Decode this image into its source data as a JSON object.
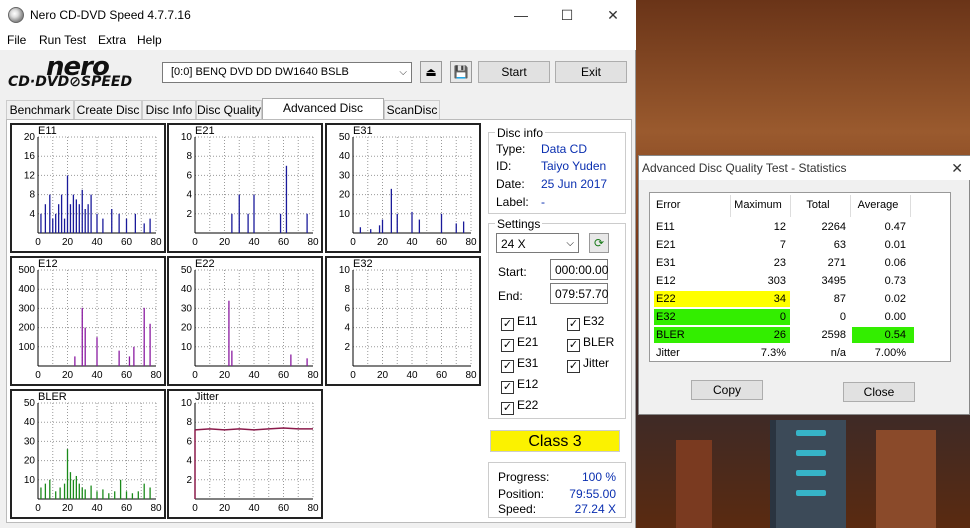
{
  "window": {
    "title": "Nero CD-DVD Speed 4.7.7.16",
    "minimize": "—",
    "maximize": "☐",
    "close": "✕"
  },
  "menu": [
    "File",
    "Run Test",
    "Extra",
    "Help"
  ],
  "logo": {
    "line1": "nero",
    "line2": "CD·DVD⊘SPEED"
  },
  "drive": {
    "value": "[0:0]   BENQ DVD DD DW1640 BSLB",
    "arrow": "⌵"
  },
  "toolbar": {
    "start": "Start",
    "exit": "Exit",
    "eject_icon": "eject-icon",
    "save_icon": "floppy-save-icon"
  },
  "tabs": [
    "Benchmark",
    "Create Disc",
    "Disc Info",
    "Disc Quality",
    "Advanced Disc Quality",
    "ScanDisc"
  ],
  "active_tab": 4,
  "disc_info": {
    "label": "Disc info",
    "type_label": "Type:",
    "type": "Data CD",
    "id_label": "ID:",
    "id": "Taiyo Yuden",
    "date_label": "Date:",
    "date": "25 Jun 2017",
    "label_label": "Label:",
    "label_value": "-"
  },
  "settings": {
    "label": "Settings",
    "speed": "24 X",
    "start_label": "Start:",
    "start": "000:00.00",
    "end_label": "End:",
    "end": "079:57.70"
  },
  "checks": [
    {
      "label": "E11",
      "checked": true
    },
    {
      "label": "E32",
      "checked": true
    },
    {
      "label": "E21",
      "checked": true
    },
    {
      "label": "BLER",
      "checked": true
    },
    {
      "label": "E31",
      "checked": true
    },
    {
      "label": "Jitter",
      "checked": true
    },
    {
      "label": "E12",
      "checked": true
    },
    {
      "label": "E22",
      "checked": true
    }
  ],
  "class_label": "Class 3",
  "progress": {
    "progress_label": "Progress:",
    "progress": "100 %",
    "position_label": "Position:",
    "position": "79:55.00",
    "speed_label": "Speed:",
    "speed": "27.24 X"
  },
  "charts": [
    {
      "name": "E11",
      "ymax": 20,
      "yticks": [
        "20",
        "16",
        "12",
        "8",
        "4"
      ],
      "color": "#1a1a9a",
      "xticks": [
        "0",
        "20",
        "40",
        "60",
        "80"
      ],
      "type": "bar"
    },
    {
      "name": "E21",
      "ymax": 10,
      "yticks": [
        "10",
        "8",
        "6",
        "4",
        "2"
      ],
      "color": "#1a1a9a",
      "xticks": [
        "0",
        "20",
        "40",
        "60",
        "80"
      ],
      "type": "bar"
    },
    {
      "name": "E31",
      "ymax": 50,
      "yticks": [
        "50",
        "40",
        "30",
        "20",
        "10"
      ],
      "color": "#1a1a9a",
      "xticks": [
        "0",
        "20",
        "40",
        "60",
        "80"
      ],
      "type": "bar"
    },
    {
      "name": "E12",
      "ymax": 500,
      "yticks": [
        "500",
        "400",
        "300",
        "200",
        "100"
      ],
      "color": "#8a1aa0",
      "xticks": [
        "0",
        "20",
        "40",
        "60",
        "80"
      ],
      "type": "bar"
    },
    {
      "name": "E22",
      "ymax": 50,
      "yticks": [
        "50",
        "40",
        "30",
        "20",
        "10"
      ],
      "color": "#8a1aa0",
      "xticks": [
        "0",
        "20",
        "40",
        "60",
        "80"
      ],
      "type": "bar"
    },
    {
      "name": "E32",
      "ymax": 10,
      "yticks": [
        "10",
        "8",
        "6",
        "4",
        "2"
      ],
      "color": "#8a1aa0",
      "xticks": [
        "0",
        "20",
        "40",
        "60",
        "80"
      ],
      "type": "bar"
    },
    {
      "name": "BLER",
      "ymax": 50,
      "yticks": [
        "50",
        "40",
        "30",
        "20",
        "10"
      ],
      "color": "#1a8a1a",
      "xticks": [
        "0",
        "20",
        "40",
        "60",
        "80"
      ],
      "type": "bar"
    },
    {
      "name": "Jitter",
      "ymax": 10,
      "yticks": [
        "10",
        "8",
        "6",
        "4",
        "2"
      ],
      "color": "#8a1a4a",
      "xticks": [
        "0",
        "20",
        "40",
        "60",
        "80"
      ],
      "type": "line"
    }
  ],
  "chart_data": [
    {
      "type": "bar",
      "title": "E11",
      "x": [
        2,
        5,
        8,
        10,
        12,
        14,
        16,
        18,
        20,
        22,
        24,
        26,
        28,
        30,
        32,
        34,
        36,
        40,
        44,
        50,
        55,
        60,
        66,
        72,
        76
      ],
      "y": [
        4,
        6,
        8,
        3,
        4,
        6,
        8,
        3,
        12,
        6,
        8,
        7,
        6,
        9,
        5,
        6,
        8,
        4,
        3,
        5,
        4,
        3,
        4,
        2,
        3
      ],
      "ylim": [
        0,
        20
      ],
      "xlim": [
        0,
        80
      ]
    },
    {
      "type": "bar",
      "title": "E21",
      "x": [
        25,
        30,
        36,
        40,
        58,
        62,
        76
      ],
      "y": [
        2,
        4,
        2,
        4,
        2,
        7,
        2
      ],
      "ylim": [
        0,
        10
      ],
      "xlim": [
        0,
        80
      ]
    },
    {
      "type": "bar",
      "title": "E31",
      "x": [
        5,
        12,
        18,
        20,
        26,
        30,
        40,
        45,
        60,
        70,
        75
      ],
      "y": [
        3,
        2,
        4,
        7,
        23,
        10,
        11,
        7,
        10,
        5,
        6
      ],
      "ylim": [
        0,
        50
      ],
      "xlim": [
        0,
        80
      ]
    },
    {
      "type": "bar",
      "title": "E12",
      "x": [
        25,
        30,
        32,
        40,
        55,
        62,
        65,
        72,
        76
      ],
      "y": [
        50,
        303,
        200,
        150,
        80,
        50,
        100,
        303,
        220
      ],
      "ylim": [
        0,
        500
      ],
      "xlim": [
        0,
        80
      ]
    },
    {
      "type": "bar",
      "title": "E22",
      "x": [
        23,
        25,
        65,
        76
      ],
      "y": [
        34,
        8,
        6,
        4
      ],
      "ylim": [
        0,
        50
      ],
      "xlim": [
        0,
        80
      ]
    },
    {
      "type": "bar",
      "title": "E32",
      "x": [],
      "y": [],
      "ylim": [
        0,
        10
      ],
      "xlim": [
        0,
        80
      ]
    },
    {
      "type": "bar",
      "title": "BLER",
      "x": [
        2,
        5,
        8,
        12,
        15,
        18,
        20,
        22,
        24,
        26,
        28,
        30,
        32,
        36,
        40,
        44,
        48,
        52,
        56,
        60,
        64,
        68,
        72,
        76
      ],
      "y": [
        6,
        8,
        10,
        4,
        6,
        8,
        26,
        14,
        10,
        12,
        8,
        6,
        5,
        7,
        4,
        5,
        3,
        4,
        10,
        4,
        3,
        4,
        8,
        6
      ],
      "ylim": [
        0,
        50
      ],
      "xlim": [
        0,
        80
      ]
    },
    {
      "type": "line",
      "title": "Jitter",
      "x": [
        0,
        10,
        20,
        30,
        40,
        50,
        60,
        70,
        80
      ],
      "y": [
        7.2,
        7.3,
        7.2,
        7.3,
        7.2,
        7.3,
        7.4,
        7.3,
        7.3
      ],
      "ylim": [
        0,
        10
      ],
      "xlim": [
        0,
        80
      ]
    }
  ],
  "stats": {
    "title": "Advanced Disc Quality Test - Statistics",
    "close": "✕",
    "headers": [
      "Error",
      "Maximum",
      "Total",
      "Average"
    ],
    "rows": [
      {
        "e": "E11",
        "max": "12",
        "total": "2264",
        "avg": "0.47"
      },
      {
        "e": "E21",
        "max": "7",
        "total": "63",
        "avg": "0.01"
      },
      {
        "e": "E31",
        "max": "23",
        "total": "271",
        "avg": "0.06"
      },
      {
        "e": "E12",
        "max": "303",
        "total": "3495",
        "avg": "0.73"
      },
      {
        "e": "E22",
        "max": "34",
        "total": "87",
        "avg": "0.02"
      },
      {
        "e": "E32",
        "max": "0",
        "total": "0",
        "avg": "0.00"
      },
      {
        "e": "BLER",
        "max": "26",
        "total": "2598",
        "avg": "0.54"
      },
      {
        "e": "Jitter",
        "max": "7.3%",
        "total": "n/a",
        "avg": "7.00%"
      }
    ],
    "highlight": {
      "yellow": "#ffff00",
      "green": "#33ee00"
    },
    "copy": "Copy",
    "close_btn": "Close"
  }
}
